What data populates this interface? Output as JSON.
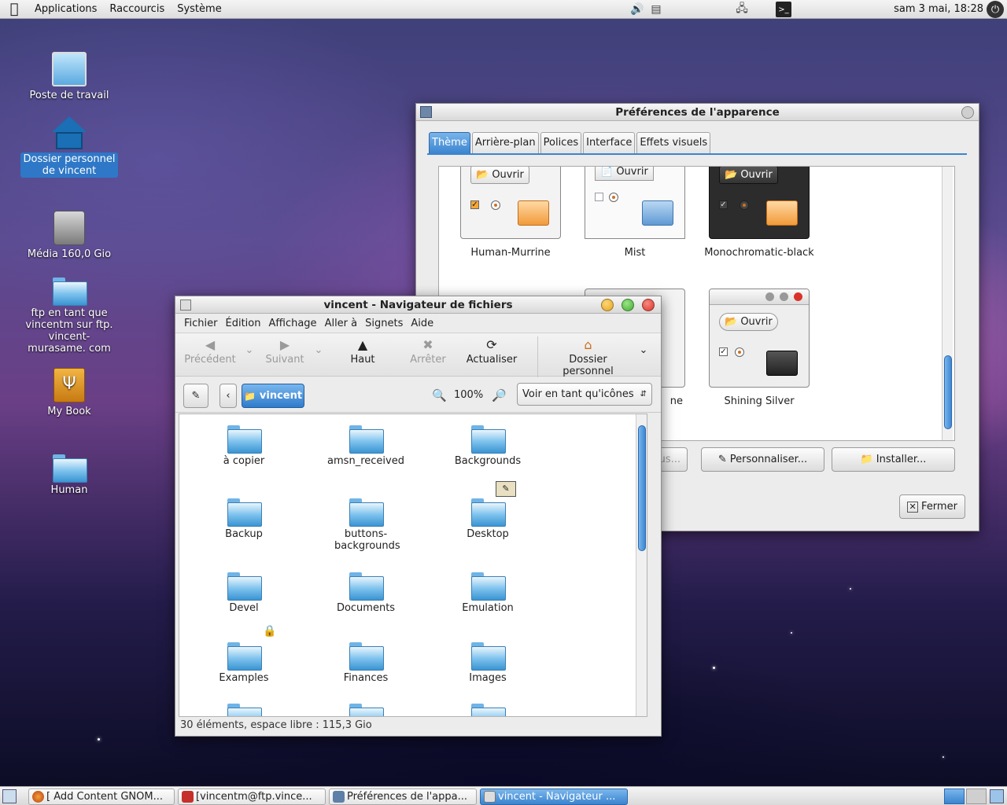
{
  "top_panel": {
    "menus": [
      "Applications",
      "Raccourcis",
      "Système"
    ],
    "clock": "sam  3 mai, 18:28",
    "icons": [
      "apple-icon",
      "volume-icon",
      "network-monitor-icon",
      "network-icon",
      "terminal-icon",
      "power-icon"
    ]
  },
  "desktop": {
    "icons": [
      {
        "label": "Poste de travail",
        "icon": "computer-icon"
      },
      {
        "label": "Dossier personnel de vincent",
        "icon": "home-icon"
      },
      {
        "label": "Média 160,0 Gio",
        "icon": "harddrive-icon"
      },
      {
        "label": "ftp en tant que vincentm sur ftp. vincent-murasame. com",
        "icon": "network-folder-icon"
      },
      {
        "label": "My Book",
        "icon": "usb-drive-icon"
      },
      {
        "label": "Human",
        "icon": "folder-icon"
      }
    ]
  },
  "prefs_window": {
    "title": "Préférences de l'apparence",
    "tabs": [
      "Thème",
      "Arrière-plan",
      "Polices",
      "Interface",
      "Effets visuels"
    ],
    "active_tab": "Thème",
    "preview_button": "Ouvrir",
    "themes": [
      "Human-Murrine",
      "Mist",
      "Monochromatic-black",
      "ne",
      "Shining Silver"
    ],
    "buttons": {
      "save_partial": "ous...",
      "customize": "Personnaliser...",
      "install": "Installer...",
      "close": "Fermer"
    }
  },
  "browser_window": {
    "title": "vincent - Navigateur de fichiers",
    "menus": [
      "Fichier",
      "Édition",
      "Affichage",
      "Aller à",
      "Signets",
      "Aide"
    ],
    "toolbar": {
      "back": "Précédent",
      "forward": "Suivant",
      "up": "Haut",
      "stop": "Arrêter",
      "reload": "Actualiser",
      "home": "Dossier personnel"
    },
    "path_segment": "vincent",
    "zoom": "100%",
    "view_mode": "Voir en tant qu'icônes",
    "files": [
      "à copier",
      "amsn_received",
      "Backgrounds",
      "Backup",
      "buttons-backgrounds",
      "Desktop",
      "Devel",
      "Documents",
      "Emulation",
      "Examples",
      "Finances",
      "Images"
    ],
    "status": "30 éléments, espace libre : 115,3 Gio"
  },
  "taskbar": {
    "tasks": [
      "[ Add Content GNOM...",
      "[vincentm@ftp.vince...",
      "Préférences de l'appa...",
      "vincent - Navigateur ..."
    ],
    "active_task": 3
  },
  "colors": {
    "accent": "#3b85d0",
    "selection": "#2f78c7",
    "close_red": "#d9322a",
    "minimize_orange": "#e8a21c",
    "maximize_green": "#3fae2e"
  }
}
